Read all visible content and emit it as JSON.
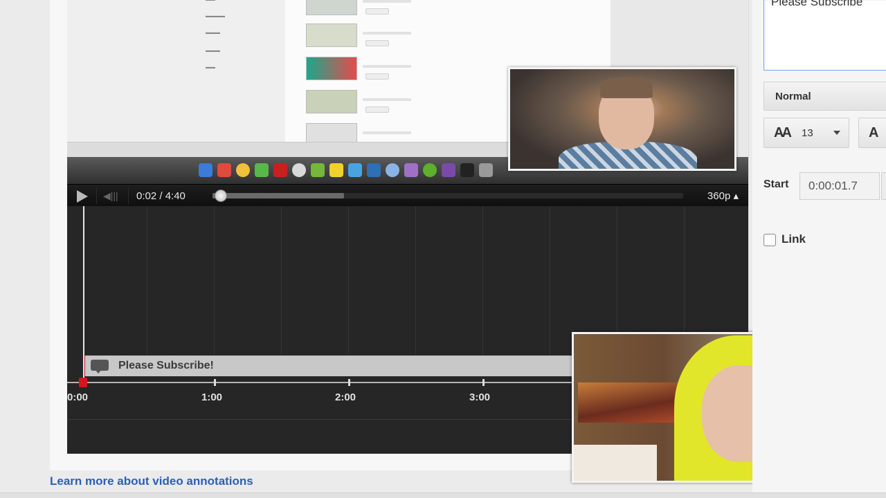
{
  "player": {
    "time_display": "0:02 / 4:40",
    "quality": "360p",
    "progress_fraction": 0.007
  },
  "annotation": {
    "text": "Please Subscribe!"
  },
  "timeline": {
    "ticks": [
      "0:00",
      "1:00",
      "2:00",
      "3:00"
    ]
  },
  "editor": {
    "text_value": "Please Subscribe",
    "style_value": "Normal",
    "font_size": "13",
    "color_glyph": "A",
    "start_label": "Start",
    "start_value": "0:00:01.7",
    "link_label": "Link"
  },
  "footer": {
    "learn_more": "Learn more about video annotations"
  },
  "colors": {
    "accent": "#2b5fb4",
    "annotation_marker": "#cc1a1a",
    "webcam_hoodie": "#e2e62a"
  }
}
